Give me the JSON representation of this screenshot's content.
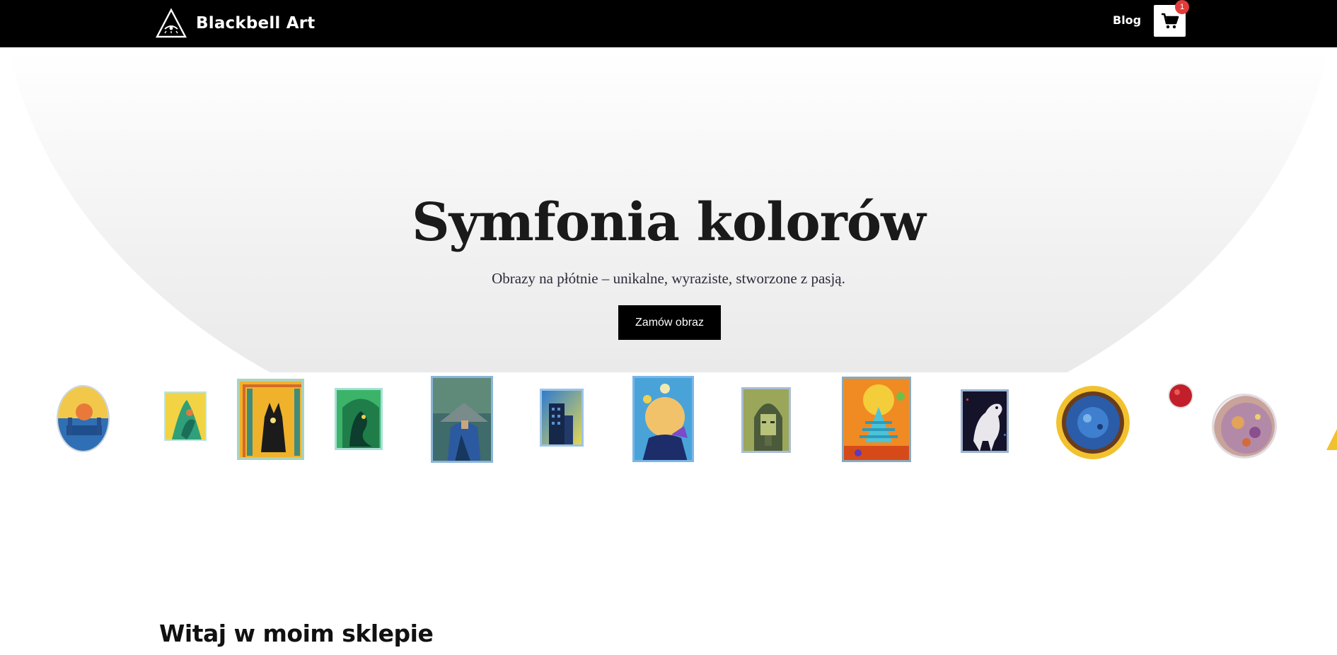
{
  "header": {
    "brand_name": "Blackbell Art",
    "nav_blog": "Blog",
    "cart_count": "1",
    "logo_icon": "eye-triangle-icon",
    "cart_icon": "cart-icon"
  },
  "hero": {
    "title": "Symfonia kolorów",
    "subtitle": "Obrazy na płótnie – unikalne, wyraziste, stworzone z pasją.",
    "cta_label": "Zamów obraz"
  },
  "gallery": {
    "items": [
      "painting-1",
      "painting-2",
      "painting-3",
      "painting-4",
      "painting-5",
      "painting-6",
      "painting-7",
      "painting-8",
      "painting-9",
      "painting-10",
      "painting-11",
      "painting-12",
      "painting-13",
      "painting-14"
    ]
  },
  "section": {
    "title": "Witaj w moim sklepie"
  },
  "colors": {
    "accent": "#000000",
    "badge": "#e23b3b"
  }
}
